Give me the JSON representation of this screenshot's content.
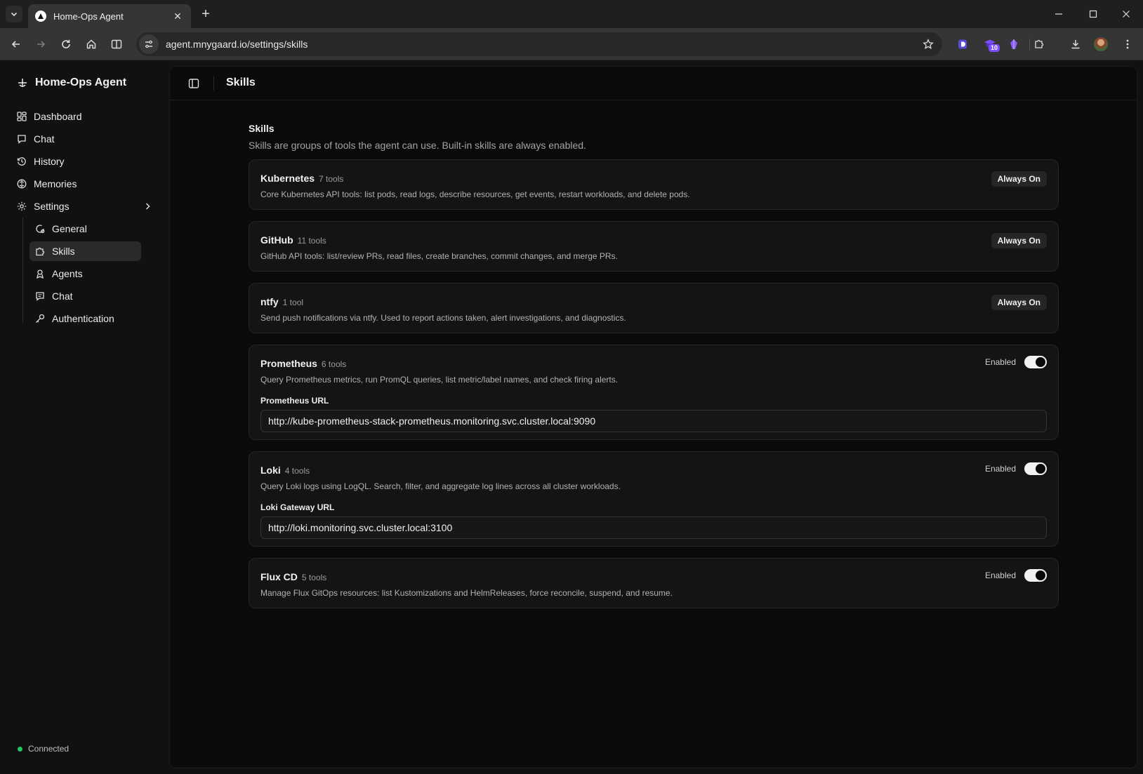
{
  "browser": {
    "tab_title": "Home-Ops Agent",
    "url": "agent.mnygaard.io/settings/skills",
    "extension_badge": "10"
  },
  "sidebar": {
    "brand": "Home-Ops Agent",
    "nav": [
      {
        "label": "Dashboard",
        "icon": "dashboard-icon"
      },
      {
        "label": "Chat",
        "icon": "chat-icon"
      },
      {
        "label": "History",
        "icon": "history-icon"
      },
      {
        "label": "Memories",
        "icon": "memories-icon"
      },
      {
        "label": "Settings",
        "icon": "gear-icon"
      }
    ],
    "settings_sub": [
      {
        "label": "General",
        "icon": "general-icon"
      },
      {
        "label": "Skills",
        "icon": "puzzle-icon",
        "active": true
      },
      {
        "label": "Agents",
        "icon": "agents-icon"
      },
      {
        "label": "Chat",
        "icon": "chat-icon"
      },
      {
        "label": "Authentication",
        "icon": "key-icon"
      }
    ],
    "status": "Connected",
    "status_color": "#22c55e"
  },
  "header": {
    "title": "Skills"
  },
  "skills_section": {
    "title": "Skills",
    "description": "Skills are groups of tools the agent can use. Built-in skills are always enabled."
  },
  "skills": [
    {
      "name": "Kubernetes",
      "count": "7 tools",
      "description": "Core Kubernetes API tools: list pods, read logs, describe resources, get events, restart workloads, and delete pods.",
      "badge": "Always On"
    },
    {
      "name": "GitHub",
      "count": "11 tools",
      "description": "GitHub API tools: list/review PRs, read files, create branches, commit changes, and merge PRs.",
      "badge": "Always On"
    },
    {
      "name": "ntfy",
      "count": "1 tool",
      "description": "Send push notifications via ntfy. Used to report actions taken, alert investigations, and diagnostics.",
      "badge": "Always On"
    },
    {
      "name": "Prometheus",
      "count": "6 tools",
      "description": "Query Prometheus metrics, run PromQL queries, list metric/label names, and check firing alerts.",
      "toggle_label": "Enabled",
      "enabled": true,
      "field_label": "Prometheus URL",
      "field_value": "http://kube-prometheus-stack-prometheus.monitoring.svc.cluster.local:9090"
    },
    {
      "name": "Loki",
      "count": "4 tools",
      "description": "Query Loki logs using LogQL. Search, filter, and aggregate log lines across all cluster workloads.",
      "toggle_label": "Enabled",
      "enabled": true,
      "field_label": "Loki Gateway URL",
      "field_value": "http://loki.monitoring.svc.cluster.local:3100"
    },
    {
      "name": "Flux CD",
      "count": "5 tools",
      "description": "Manage Flux GitOps resources: list Kustomizations and HelmReleases, force reconcile, suspend, and resume.",
      "toggle_label": "Enabled",
      "enabled": true
    }
  ]
}
